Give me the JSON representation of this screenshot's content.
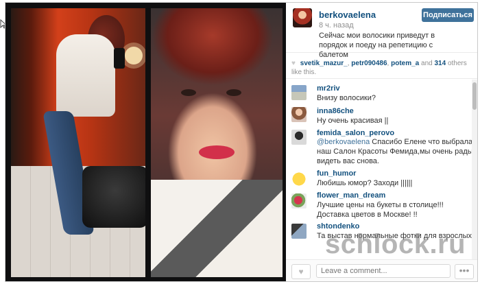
{
  "post": {
    "username": "berkovaelena",
    "time": "8 ч. назад",
    "caption": "Сейчас мои волосики приведут в порядок и поеду на репетицию с балетом",
    "subscribe_label": "Подписаться"
  },
  "likes": {
    "users": [
      "svetik_mazur_",
      "petr090486",
      "potem_a"
    ],
    "sep1": ", ",
    "sep2": ", ",
    "and": " and ",
    "count": "314",
    "others": " others like this."
  },
  "comments": [
    {
      "user": "mr2riv",
      "text": "Внизу волосики?"
    },
    {
      "user": "inna86che",
      "text": "Ну очень красивая ||"
    },
    {
      "user": "femida_salon_perovo",
      "mention": "@berkovaelena",
      "text": " Спасибо Елене что выбрала наш Салон Красоты Фемида,мы очень рады видеть вас снова."
    },
    {
      "user": "fun_humor",
      "text": "Любишь юмор? Заходи ||||||"
    },
    {
      "user": "flower_man_dream",
      "text": "Лучшие цены на букеты в столице!!! Доставка цветов в Москве! !!"
    },
    {
      "user": "shtondenko",
      "text": "Та выстав нормальные фотки для взрослых!"
    }
  ],
  "footer": {
    "comment_placeholder": "Leave a comment...",
    "more_label": "•••"
  },
  "watermark": "schlock.ru",
  "icons": [
    "heart-icon",
    "heart-outline-icon",
    "more-icon",
    "cursor-icon"
  ]
}
